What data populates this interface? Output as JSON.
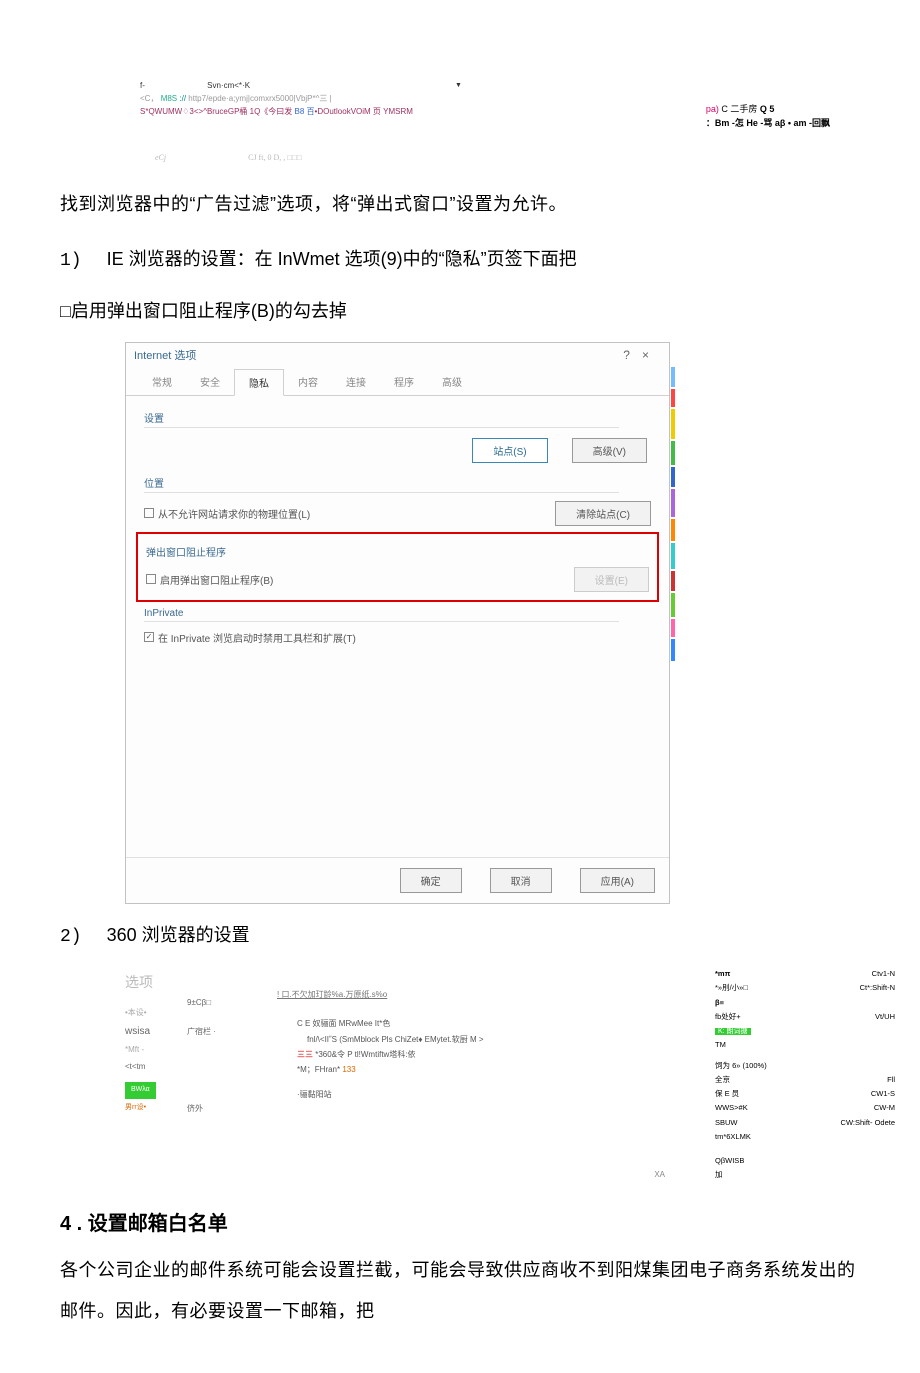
{
  "browser_snippet": {
    "line1_left": "f-",
    "line1_mid": "Svn·cm<*·K",
    "arrow": "▼",
    "url_prefix": "<C，",
    "url_green": "M8S",
    "url_teal": "://",
    "url_body": "http7/epde·a;ymj|comxrx5000|VbjP*^三 |",
    "taskbar": "S*QWUMW",
    "taskbar_green": "♢3",
    "taskbar2": "<>^BruceGP桶 1Q《今曰发",
    "taskbar_blue": "B8 百",
    "taskbar3": "•DOutlookVOiM 页 YMSRM",
    "right_r1a": "pa)",
    "right_r1b": " C 二手房",
    "right_r1c": " Q 5",
    "right_r2": "：Bm -怎 He -骂 aβ • am -回飘",
    "bottom_left": "eCj",
    "bottom_right": "CJ ft, 0 D, , □□□"
  },
  "para1": "找到浏览器中的“广告过滤”选项，将“弹出式窗口”设置为允许。",
  "step1_label": "1)",
  "step1_text": "IE 浏览器的设置：在 InWmet 选项(9)中的“隐私”页签下面把",
  "step1_cont": "□启用弹出窗口阻止程序(B)的勾去掉",
  "ie": {
    "title": "Internet 选项",
    "help": "?",
    "close": "×",
    "tabs": [
      "常规",
      "安全",
      "隐私",
      "内容",
      "连接",
      "程序",
      "高级"
    ],
    "section_settings": "设置",
    "btn_sites": "站点(S)",
    "btn_advanced": "高级(V)",
    "section_location": "位置",
    "check_location": "从不允许网站请求你的物理位置(L)",
    "btn_clear_sites": "清除站点(C)",
    "section_popup": "弹出窗口阻止程序",
    "check_popup": "启用弹出窗口阻止程序(B)",
    "btn_popup_settings": "设置(E)",
    "section_inprivate": "InPrivate",
    "check_inprivate": "在 InPrivate 浏览启动时禁用工具栏和扩展(T)",
    "btn_ok": "确定",
    "btn_cancel": "取消",
    "btn_apply": "应用(A)"
  },
  "step2_label": "2)",
  "step2_text": "360 浏览器的设置",
  "opt": {
    "title": "选项",
    "side": [
      "•本设•",
      "wsisa",
      "*Mft -",
      "<t<tm"
    ],
    "side_green": "ΒWλα",
    "side_orange": "男rr设•",
    "col2a": "9±Cβ□",
    "col2b": "广宿栏 ·",
    "col2c": "侪外",
    "main_under": "! 口.不欠加玎龄%a.万原纸.s%o",
    "main1": "C E 奴骊面 MRwMee It*色",
    "main2": "fnl/\\<IIˮS (SmMblock Pls ChiZet♦ EMytet.软厨 M >",
    "main2_red": "三三",
    "main3": " *360&令 P tl!Wmtiftw塔科:依",
    "main4a": "*M；FHran* ",
    "main4b": "133",
    "main5": "·骊黏阳站",
    "xa": "XA",
    "right": {
      "r1a": "*mπ",
      "r1b": "Ctv1-N",
      "r2a": "*»刖/小»□ ",
      "r2b": "Ct*:Shift-N",
      "r3a": "β≡",
      "r4a": "fb处好+",
      "r4b": "Vt/UH",
      "r5": "K: 朗词搪",
      "r6": "TM",
      "r7a": "饲为 6» (100%)",
      "r8a": "全京",
      "r8b": "Fll",
      "r9a": "保 E 员",
      "r9b": "CW1-S",
      "r10a": "WWS>#K",
      "r10b": "CW-M",
      "r11a": "SBUW",
      "r11b": "CW:Shift- Odete",
      "r12a": "tm*6XLMK",
      "r13a": "QβWISB",
      "r14a": "加"
    }
  },
  "heading4": "4 . 设置邮箱白名单",
  "body4": "各个公司企业的邮件系统可能会设置拦截，可能会导致供应商收不到阳煤集团电子商务系统发出的邮件。因此，有必要设置一下邮箱，把"
}
